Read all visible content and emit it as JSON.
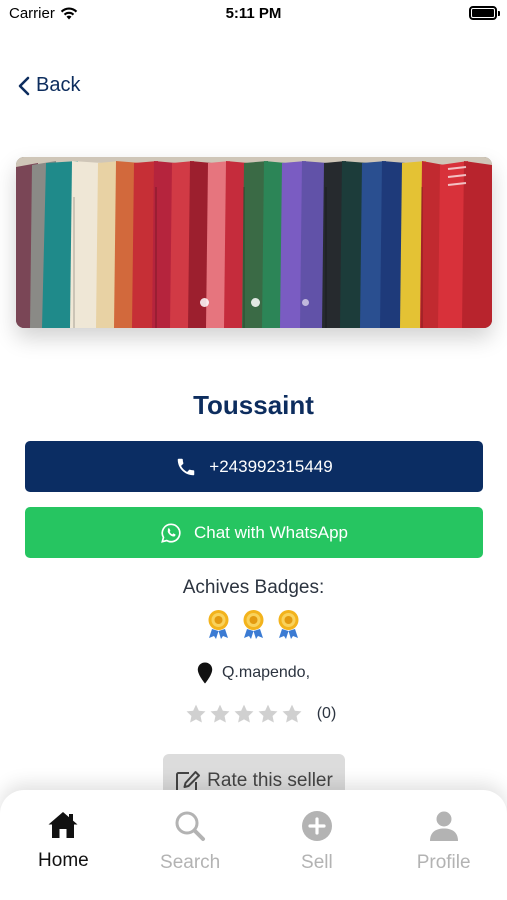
{
  "status_bar": {
    "carrier": "Carrier",
    "time": "5:11 PM"
  },
  "nav": {
    "back_label": "Back"
  },
  "carousel": {
    "slide_count": 3,
    "active_index": 1
  },
  "seller": {
    "name": "Toussaint"
  },
  "actions": {
    "phone": "+243992315449",
    "whatsapp_label": "Chat with WhatsApp"
  },
  "badges": {
    "title": "Achives Badges:",
    "count": 3
  },
  "location": {
    "text": "Q.mapendo,"
  },
  "rating": {
    "value": 0,
    "max": 5,
    "count_label": "(0)"
  },
  "rate_button": {
    "label": "Rate this seller"
  },
  "tabs": [
    {
      "label": "Home",
      "icon": "home-icon",
      "active": true
    },
    {
      "label": "Search",
      "icon": "search-icon",
      "active": false
    },
    {
      "label": "Sell",
      "icon": "plus-circle-icon",
      "active": false
    },
    {
      "label": "Profile",
      "icon": "person-icon",
      "active": false
    }
  ],
  "colors": {
    "primary": "#0b2d63",
    "whatsapp": "#26c561",
    "star_empty": "#d0d0d0",
    "tab_inactive": "#b3b3b3",
    "tab_active": "#111111"
  }
}
